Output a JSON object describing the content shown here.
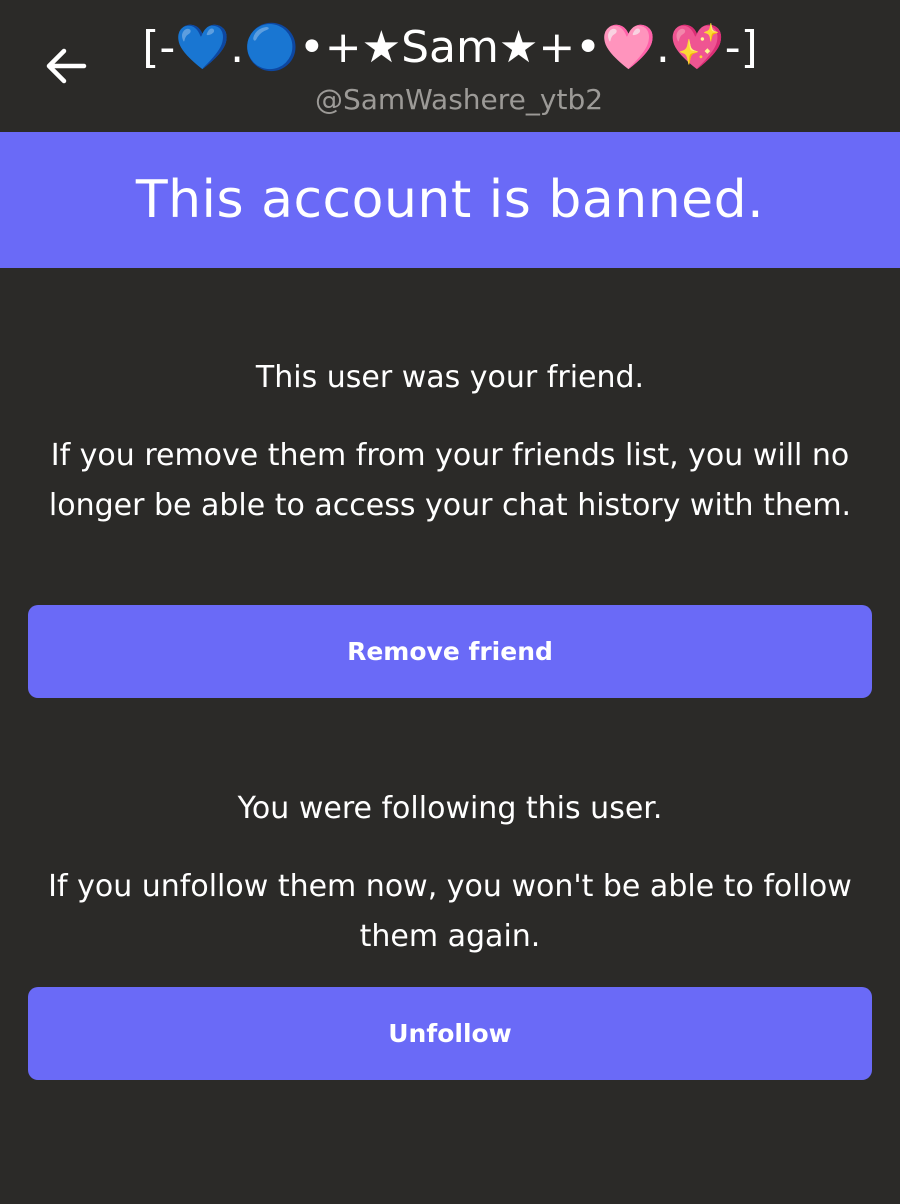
{
  "header": {
    "back_icon": "arrow-left-icon",
    "title": "[-💙.🔵•+★Sam★+•🩷.💖-]",
    "handle": "@SamWashere_ytb2"
  },
  "banner": {
    "text": "This account is banned."
  },
  "friend_section": {
    "heading": "This user was your friend.",
    "body": "If you remove them from your friends list, you will no longer be able to access your chat history with them.",
    "button_label": "Remove friend"
  },
  "follow_section": {
    "heading": "You were following this user.",
    "body": "If you unfollow them now, you won't be able to follow them again.",
    "button_label": "Unfollow"
  },
  "colors": {
    "background": "#2b2a28",
    "accent": "#6a6af7",
    "muted_text": "#9c9a97"
  }
}
